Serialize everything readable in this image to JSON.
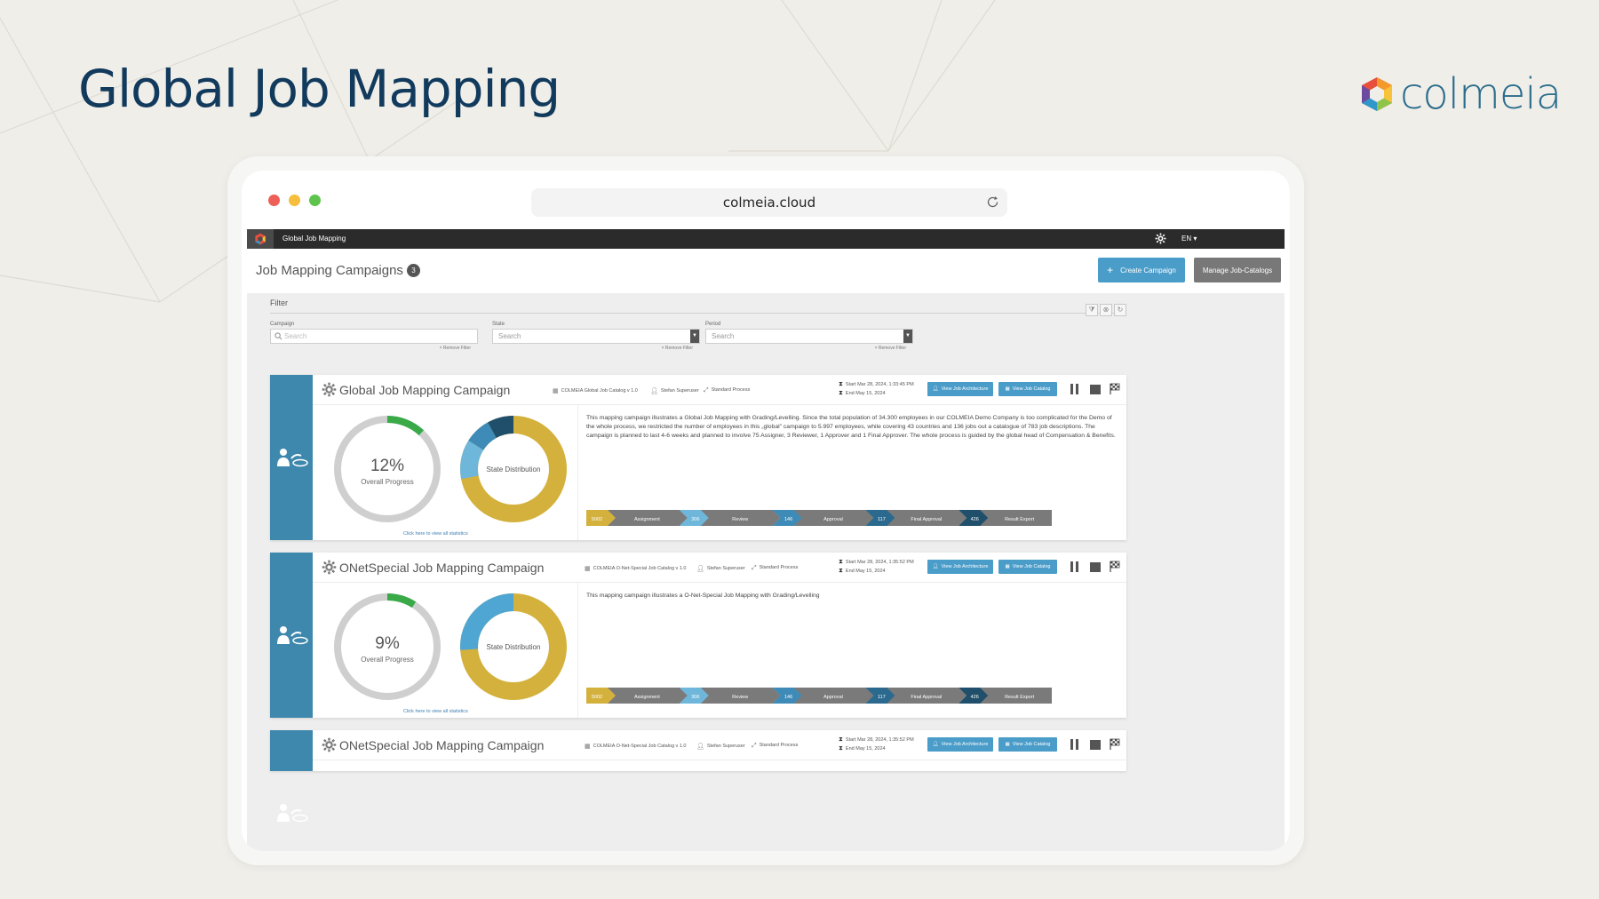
{
  "slide": {
    "title": "Global Job Mapping",
    "brand": "colmeia"
  },
  "browser": {
    "url": "colmeia.cloud"
  },
  "app": {
    "title": "Global Job Mapping",
    "language": "EN ▾"
  },
  "header": {
    "title": "Job Mapping Campaigns",
    "count": "3",
    "create_label": "Create Campaign",
    "manage_label": "Manage Job-Catalogs"
  },
  "filter": {
    "title": "Filter",
    "fields": [
      {
        "label": "Campaign",
        "placeholder": "Search",
        "remove": "× Remove Filter"
      },
      {
        "label": "State",
        "placeholder": "Search",
        "remove": "× Remove Filter"
      },
      {
        "label": "Period",
        "placeholder": "Search",
        "remove": "× Remove Filter"
      }
    ]
  },
  "campaigns": [
    {
      "title": "Global Job Mapping Campaign",
      "catalog": "COLMEIA Global Job Catalog v 1.0",
      "user": "Stefan Superuser",
      "process": "Standard Process",
      "start": "Start Mar 28, 2024, 1:33:45 PM",
      "end": "End May 15, 2024",
      "view_architecture": "View Job Architecture",
      "view_catalog": "View Job Catalog",
      "progress_pct": "12%",
      "progress_value": 12,
      "progress_label": "Overall Progress",
      "state_label": "State Distribution",
      "stats_link": "Click here to view all statistics",
      "description": "This mapping campaign illustrates a Global Job Mapping with Grading/Levelling. Since the total population of 34.300 employees in our COLMEIA Demo Company is too complicated for the Demo of the whole process, we restricted the number of employees in this „global\" campaign to 5.997 employees, while covering 43 countries and 136 jobs out a catalogue of 783 job descriptions. The campaign is planned to last 4-6 weeks and planned to involve 75 Assigner, 3 Reviewer, 1 Approver and 1 Final Approver. The whole process is guided by the global head of Compensation & Benefits."
    },
    {
      "title": "ONetSpecial Job Mapping Campaign",
      "catalog": "COLMEIA O-Net-Special Job Catalog v 1.0",
      "user": "Stefan Superuser",
      "process": "Standard Process",
      "start": "Start Mar 28, 2024, 1:35:52 PM",
      "end": "End May 15, 2024",
      "view_architecture": "View Job Architecture",
      "view_catalog": "View Job Catalog",
      "progress_pct": "9%",
      "progress_value": 9,
      "progress_label": "Overall Progress",
      "state_label": "State Distribution",
      "stats_link": "Click here to view all statistics",
      "description": "This mapping campaign illustrates a O-Net-Special Job Mapping with Grading/Levelling"
    },
    {
      "title": "ONetSpecial Job Mapping Campaign",
      "catalog": "COLMEIA O-Net-Special Job Catalog v 1.0",
      "user": "Stefan Superuser",
      "process": "Standard Process",
      "start": "Start Mar 28, 2024, 1:35:52 PM",
      "end": "End May 15, 2024",
      "view_architecture": "View Job Architecture",
      "view_catalog": "View Job Catalog"
    }
  ],
  "pipeline": [
    {
      "count": "5002",
      "stage": "Assignment",
      "color": "#d4b13c"
    },
    {
      "count": "306",
      "stage": "Review",
      "color": "#6fb7da"
    },
    {
      "count": "146",
      "stage": "Approval",
      "color": "#3f8bb8"
    },
    {
      "count": "117",
      "stage": "Final Approval",
      "color": "#2b6a8e"
    },
    {
      "count": "426",
      "stage": "Result Export",
      "color": "#1f4f6a"
    }
  ],
  "colors": {
    "accent": "#4a9cc9",
    "stripe": "#3f88ad",
    "title": "#113a5c",
    "progress_green": "#3aaa49",
    "state_gold": "#d4b13c"
  }
}
